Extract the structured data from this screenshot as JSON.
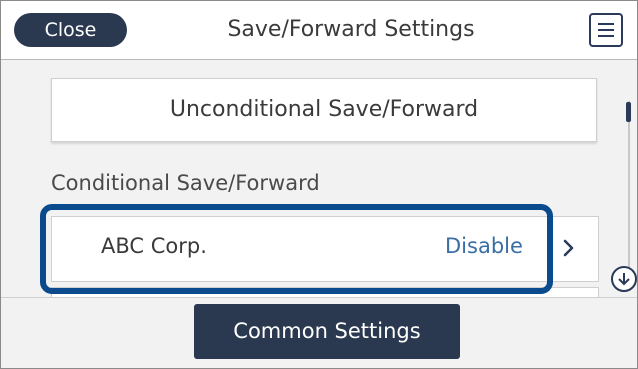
{
  "header": {
    "close_label": "Close",
    "title": "Save/Forward Settings",
    "menu_icon": "menu-list-icon"
  },
  "main": {
    "unconditional_label": "Unconditional Save/Forward",
    "conditional_section_label": "Conditional Save/Forward",
    "conditions": [
      {
        "name": "ABC Corp.",
        "status": "Disable",
        "chevron_icon": "chevron-right-icon"
      }
    ]
  },
  "scrollbar": {
    "down_icon": "arrow-down-icon"
  },
  "footer": {
    "common_settings_label": "Common Settings"
  },
  "colors": {
    "primary_dark": "#2b3950",
    "status_blue": "#3a6ea5",
    "highlight_border": "#0b4a8d"
  }
}
